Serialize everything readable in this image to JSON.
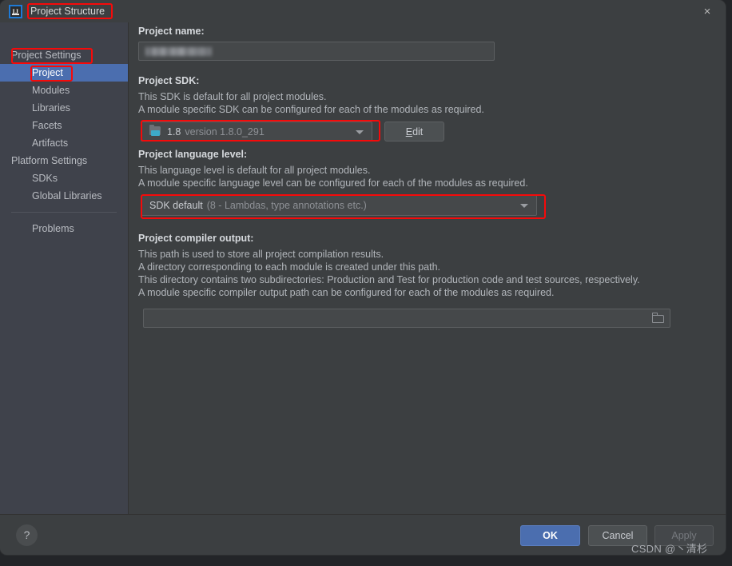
{
  "window": {
    "title": "Project Structure",
    "logo_text": "IJ",
    "close_icon": "×"
  },
  "nav": {
    "back_icon": "←",
    "forward_icon": "→"
  },
  "sidebar": {
    "items": [
      {
        "label": "Project Settings",
        "type": "group",
        "selected": false
      },
      {
        "label": "Project",
        "type": "child",
        "selected": true
      },
      {
        "label": "Modules",
        "type": "child",
        "selected": false
      },
      {
        "label": "Libraries",
        "type": "child",
        "selected": false
      },
      {
        "label": "Facets",
        "type": "child",
        "selected": false
      },
      {
        "label": "Artifacts",
        "type": "child",
        "selected": false
      },
      {
        "label": "Platform Settings",
        "type": "group",
        "selected": false
      },
      {
        "label": "SDKs",
        "type": "child",
        "selected": false
      },
      {
        "label": "Global Libraries",
        "type": "child",
        "selected": false
      },
      {
        "label": "Problems",
        "type": "child",
        "selected": false
      }
    ]
  },
  "main": {
    "project_name": {
      "label": "Project name:",
      "value": "",
      "redacted": true
    },
    "project_sdk": {
      "label": "Project SDK:",
      "desc_line1": "This SDK is default for all project modules.",
      "desc_line2": "A module specific SDK can be configured for each of the modules as required.",
      "selected_name": "1.8",
      "selected_version": "version 1.8.0_291",
      "edit_button_mnemonic": "E",
      "edit_button_rest": "dit"
    },
    "language_level": {
      "label": "Project language level:",
      "desc_line1": "This language level is default for all project modules.",
      "desc_line2": "A module specific language level can be configured for each of the modules as required.",
      "selected_name": "SDK default",
      "selected_detail": "(8 - Lambdas, type annotations etc.)"
    },
    "compiler_output": {
      "label": "Project compiler output:",
      "desc_line1": "This path is used to store all project compilation results.",
      "desc_line2": "A directory corresponding to each module is created under this path.",
      "desc_line3": "This directory contains two subdirectories: Production and Test for production code and test sources, respectively.",
      "desc_line4": "A module specific compiler output path can be configured for each of the modules as required.",
      "value": "",
      "browse_icon": "folder-icon"
    }
  },
  "footer": {
    "help_label": "?",
    "ok_label": "OK",
    "cancel_label": "Cancel",
    "apply_label": "Apply"
  },
  "watermark": {
    "text": "CSDN @丶清杉"
  },
  "colors": {
    "accent_blue": "#4b6eaf",
    "highlight_red": "#f60a0a",
    "dialog_bg": "#3c3f41",
    "sidebar_bg": "#3f424b",
    "sdk_icon_cyan": "#3dabc9"
  }
}
